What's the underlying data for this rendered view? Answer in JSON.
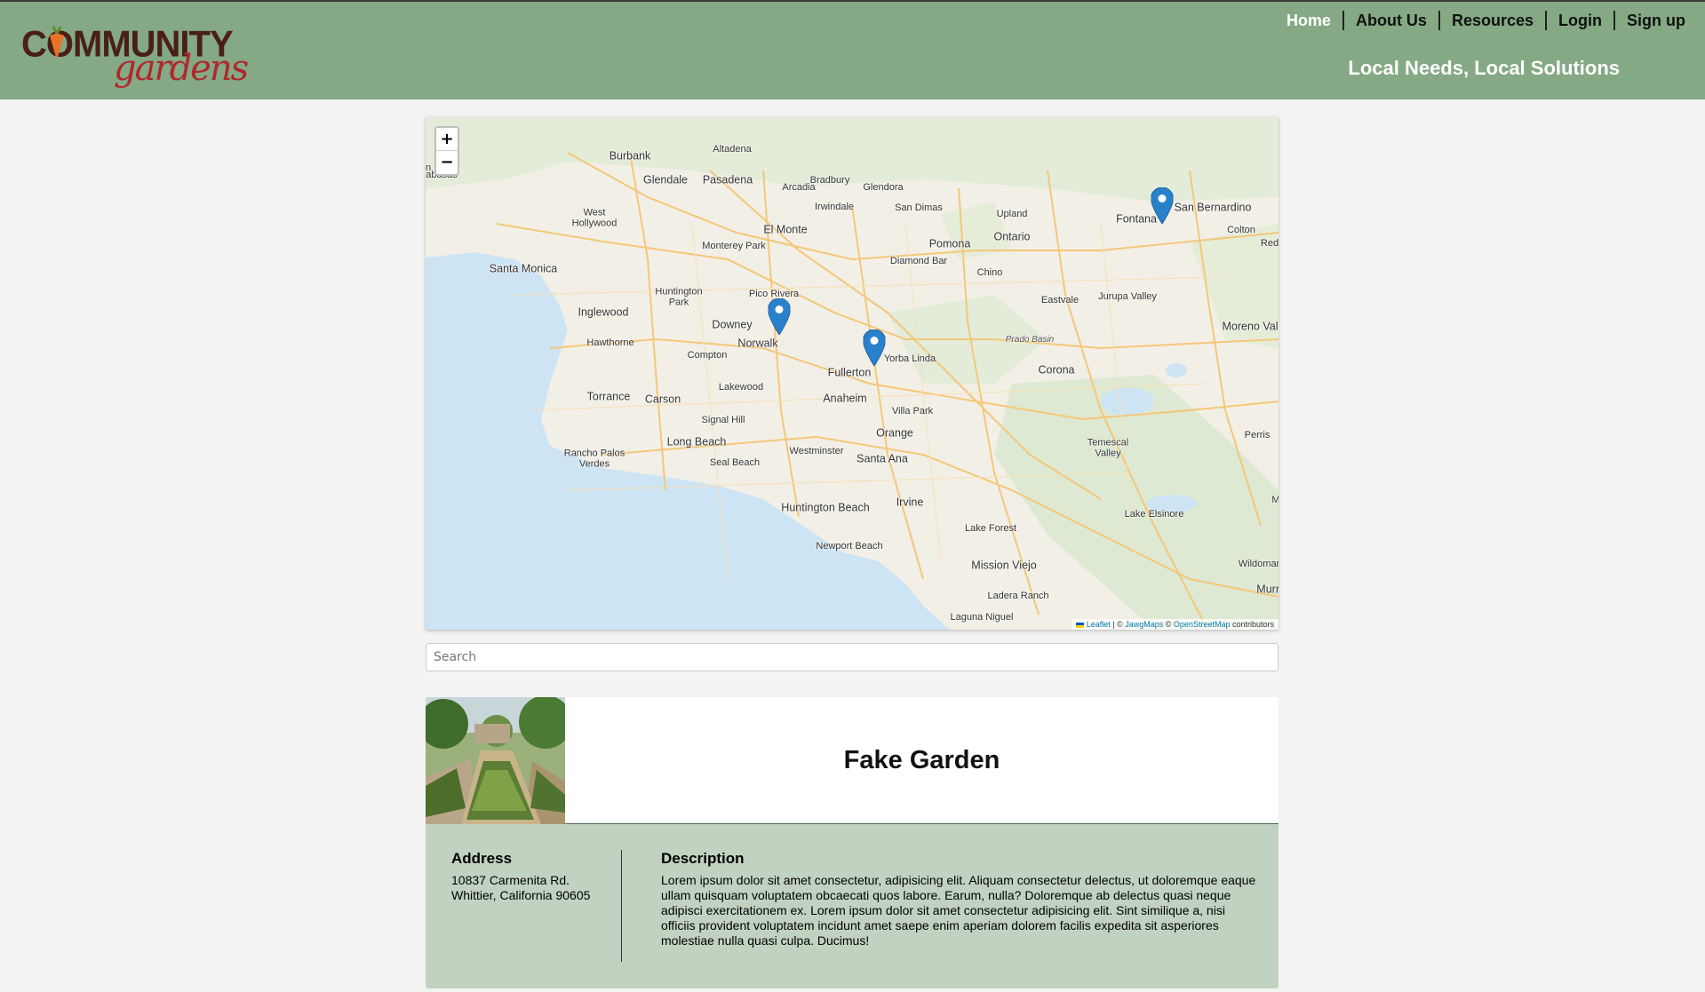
{
  "header": {
    "logo_top": "COMMUNITY",
    "logo_bottom": "gardens",
    "tagline": "Local Needs, Local Solutions",
    "nav": [
      "Home",
      "About Us",
      "Resources",
      "Login",
      "Sign up"
    ]
  },
  "map": {
    "zoom_in": "+",
    "zoom_out": "−",
    "attribution": {
      "leaflet": "Leaflet",
      "sep": " | © ",
      "jawg": "JawgMaps",
      "osm_prefix": " © ",
      "osm": "OpenStreetMap",
      "suffix": " contributors"
    },
    "labels": [
      {
        "text": "Burbank",
        "size": "md"
      },
      {
        "text": "Altadena",
        "size": "sm"
      },
      {
        "text": "Glendale",
        "size": "md"
      },
      {
        "text": "Pasadena",
        "size": "md"
      },
      {
        "text": "Bradbury",
        "size": "sm"
      },
      {
        "text": "Arcadia",
        "size": "sm"
      },
      {
        "text": "Glendora",
        "size": "sm"
      },
      {
        "text": "Irwindale",
        "size": "sm"
      },
      {
        "text": "San Dimas",
        "size": "sm"
      },
      {
        "text": "Upland",
        "size": "sm"
      },
      {
        "text": "Fontana",
        "size": "md"
      },
      {
        "text": "San Bernardino",
        "size": "md"
      },
      {
        "text": "Colton",
        "size": "sm"
      },
      {
        "text": "Red",
        "size": "sm"
      },
      {
        "text": "West\nHollywood",
        "size": "sm"
      },
      {
        "text": "El Monte",
        "size": "md"
      },
      {
        "text": "Monterey Park",
        "size": "sm"
      },
      {
        "text": "Pomona",
        "size": "md"
      },
      {
        "text": "Ontario",
        "size": "md"
      },
      {
        "text": "Diamond Bar",
        "size": "sm"
      },
      {
        "text": "Santa Monica",
        "size": "md"
      },
      {
        "text": "Chino",
        "size": "sm"
      },
      {
        "text": "Huntington\nPark",
        "size": "sm"
      },
      {
        "text": "Pico Rivera",
        "size": "sm"
      },
      {
        "text": "Eastvale",
        "size": "sm"
      },
      {
        "text": "Jurupa Valley",
        "size": "sm"
      },
      {
        "text": "Inglewood",
        "size": "md"
      },
      {
        "text": "Downey",
        "size": "md"
      },
      {
        "text": "Moreno Val",
        "size": "md"
      },
      {
        "text": "Hawthorne",
        "size": "sm"
      },
      {
        "text": "Norwalk",
        "size": "md"
      },
      {
        "text": "Prado Basin",
        "size": "it"
      },
      {
        "text": "Compton",
        "size": "sm"
      },
      {
        "text": "Yorba Linda",
        "size": "sm"
      },
      {
        "text": "Fullerton",
        "size": "md"
      },
      {
        "text": "Corona",
        "size": "md"
      },
      {
        "text": "Lakewood",
        "size": "sm"
      },
      {
        "text": "Torrance",
        "size": "md"
      },
      {
        "text": "Carson",
        "size": "md"
      },
      {
        "text": "Anaheim",
        "size": "md"
      },
      {
        "text": "Villa Park",
        "size": "sm"
      },
      {
        "text": "Signal Hill",
        "size": "sm"
      },
      {
        "text": "Orange",
        "size": "md"
      },
      {
        "text": "Perris",
        "size": "sm"
      },
      {
        "text": "Long Beach",
        "size": "md"
      },
      {
        "text": "Temescal\nValley",
        "size": "sm"
      },
      {
        "text": "Rancho Palos\nVerdes",
        "size": "sm"
      },
      {
        "text": "Westminster",
        "size": "sm"
      },
      {
        "text": "Seal Beach",
        "size": "sm"
      },
      {
        "text": "Santa Ana",
        "size": "md"
      },
      {
        "text": "Irvine",
        "size": "md"
      },
      {
        "text": "Me",
        "size": "sm"
      },
      {
        "text": "Huntington Beach",
        "size": "md"
      },
      {
        "text": "Lake Elsinore",
        "size": "sm"
      },
      {
        "text": "Lake Forest",
        "size": "sm"
      },
      {
        "text": "Newport Beach",
        "size": "sm"
      },
      {
        "text": "Wildomar",
        "size": "sm"
      },
      {
        "text": "Mission Viejo",
        "size": "md"
      },
      {
        "text": "Murrie",
        "size": "md"
      },
      {
        "text": "Ladera Ranch",
        "size": "sm"
      },
      {
        "text": "Laguna Niguel",
        "size": "sm"
      },
      {
        "text": "abasas",
        "size": "sm"
      },
      {
        "text": "n",
        "size": "sm"
      }
    ]
  },
  "search": {
    "placeholder": "Search"
  },
  "garden": {
    "name": "Fake Garden",
    "address_heading": "Address",
    "address_line1": "10837 Carmenita Rd.",
    "address_line2": "Whittier, California 90605",
    "description_heading": "Description",
    "description": "Lorem ipsum dolor sit amet consectetur, adipisicing elit. Aliquam consectetur delectus, ut doloremque eaque ullam quisquam voluptatem obcaecati quos labore. Earum, nulla? Doloremque ab delectus quasi neque adipisci exercitationem ex. Lorem ipsum dolor sit amet consectetur adipisicing elit. Sint similique a, nisi officiis provident voluptatem incidunt amet saepe enim aperiam dolorem facilis expedita sit asperiores molestiae nulla quasi culpa. Ducimus!"
  }
}
